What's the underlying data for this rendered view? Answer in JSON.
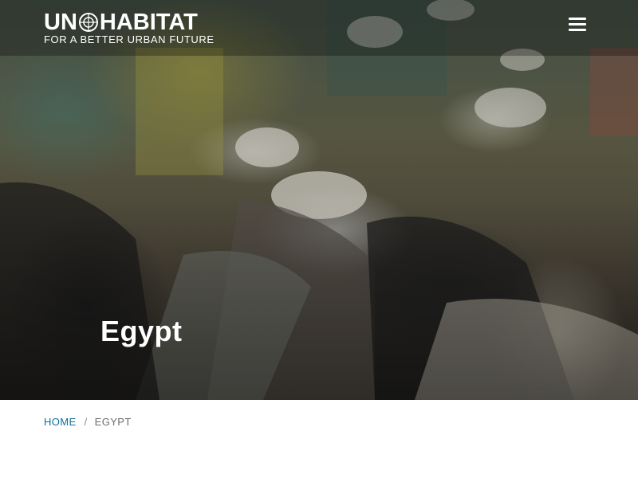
{
  "header": {
    "logo": {
      "un": "UN",
      "habitat": "HABITAT",
      "tagline": "FOR A BETTER URBAN FUTURE"
    },
    "menu_icon": "hamburger-menu-icon"
  },
  "hero": {
    "title": "Egypt"
  },
  "breadcrumb": {
    "home": "HOME",
    "separator": "/",
    "current": "EGYPT"
  },
  "colors": {
    "breadcrumb_link": "#0f6f9a",
    "breadcrumb_current": "#6d6d6d",
    "header_text": "#ffffff"
  }
}
